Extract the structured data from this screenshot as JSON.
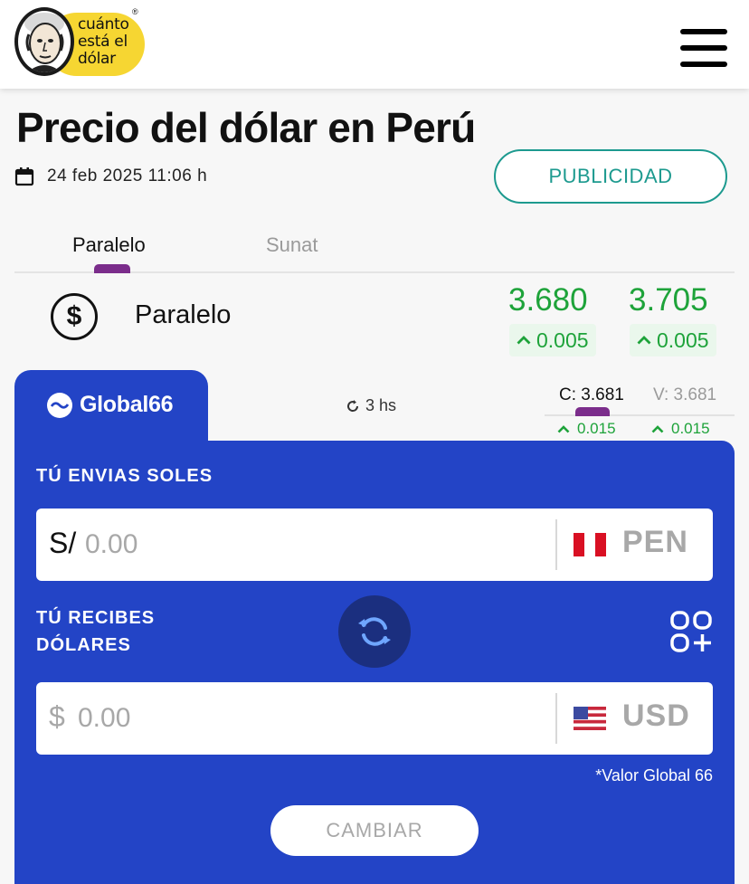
{
  "header": {
    "logo_text_line1": "cuánto",
    "logo_text_line2": "está el",
    "logo_text_line3": "dólar",
    "logo_registered": "®"
  },
  "page": {
    "title": "Precio del dólar en Perú",
    "datetime": "24 feb 2025 11:06 h",
    "publicidad_label": "PUBLICIDAD"
  },
  "tabs": [
    {
      "label": "Paralelo",
      "active": true
    },
    {
      "label": "Sunat",
      "active": false
    }
  ],
  "rate": {
    "icon": "dollar-circle-icon",
    "symbol": "$",
    "label": "Paralelo",
    "buy": "3.680",
    "buy_change": "0.005",
    "sell": "3.705",
    "sell_change": "0.005"
  },
  "provider": {
    "name": "Global66",
    "updated": "3 hs",
    "buy_label": "C: 3.681",
    "sell_label": "V: 3.681",
    "buy_change": "0.015",
    "sell_change": "0.015"
  },
  "converter": {
    "send_label_line1": "TÚ ENVIAS SOLES",
    "send_prefix": "S/",
    "send_placeholder": "0.00",
    "send_currency": "PEN",
    "receive_label_line1": "TÚ RECIBES",
    "receive_label_line2": "DÓLARES",
    "receive_prefix": "$",
    "receive_placeholder": "0.00",
    "receive_currency": "USD",
    "note": "*Valor Global 66",
    "button_label": "CAMBIAR"
  },
  "colors": {
    "panel_blue": "#2344c6",
    "accent_teal": "#1d9a8f",
    "positive_green": "#1ea33a",
    "tab_purple": "#7b2d8b",
    "logo_yellow": "#f6d632"
  }
}
